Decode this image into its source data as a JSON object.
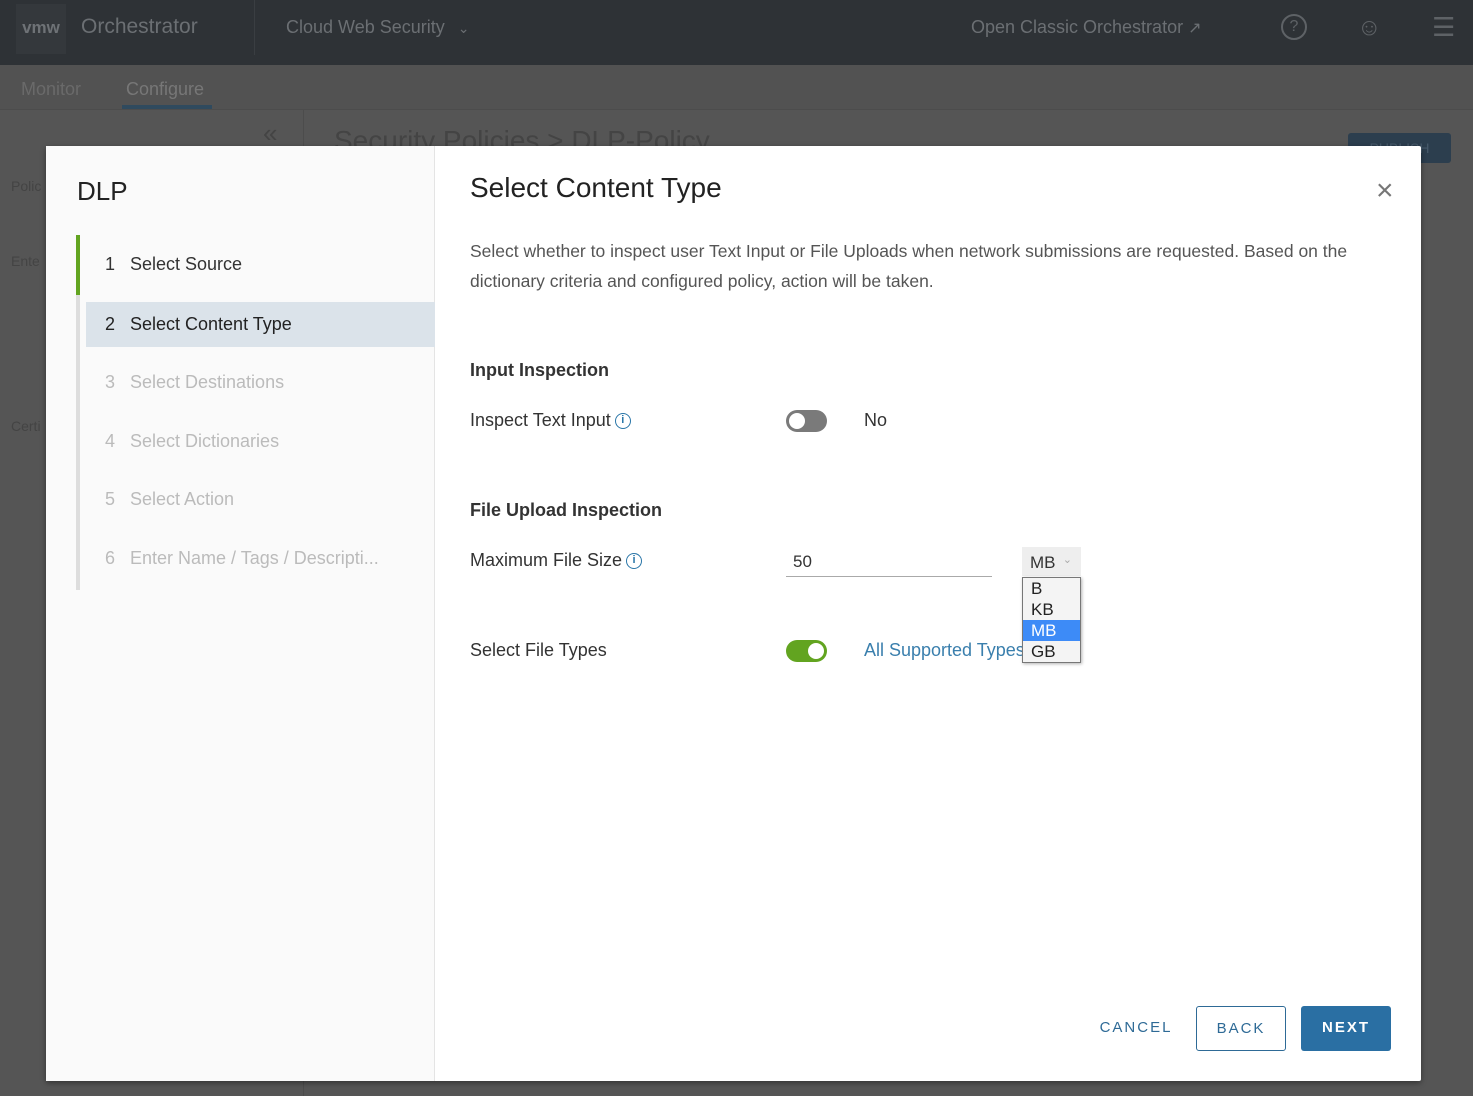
{
  "header": {
    "logo": "vmw",
    "app_name": "Orchestrator",
    "context": "Cloud Web Security",
    "open_classic": "Open Classic Orchestrator",
    "icons": [
      "external-link-icon",
      "help-icon",
      "user-icon",
      "menu-icon"
    ]
  },
  "subnav": {
    "tabs": [
      {
        "label": "Monitor"
      },
      {
        "label": "Configure",
        "active": true
      }
    ]
  },
  "background": {
    "breadcrumb": "Security Policies > DLP-Policy",
    "publish": "PUBLISH",
    "side_sections": [
      "Polic",
      "Ente",
      "Certi"
    ]
  },
  "modal": {
    "wizard_title": "DLP",
    "steps": [
      {
        "num": "1",
        "label": "Select Source",
        "state": "done"
      },
      {
        "num": "2",
        "label": "Select Content Type",
        "state": "current"
      },
      {
        "num": "3",
        "label": "Select Destinations",
        "state": "pending"
      },
      {
        "num": "4",
        "label": "Select Dictionaries",
        "state": "pending"
      },
      {
        "num": "5",
        "label": "Select Action",
        "state": "pending"
      },
      {
        "num": "6",
        "label": "Enter Name / Tags / Descripti...",
        "state": "pending"
      }
    ],
    "title": "Select Content Type",
    "description": "Select whether to inspect user Text Input or File Uploads when network submissions are requested. Based on the dictionary criteria and configured policy, action will be taken.",
    "input_inspection": {
      "heading": "Input Inspection",
      "label": "Inspect Text Input",
      "toggle_on": false,
      "value": "No"
    },
    "file_upload": {
      "heading": "File Upload Inspection",
      "max_size_label": "Maximum File Size",
      "max_size_value": "50",
      "unit": "MB",
      "unit_options": [
        "B",
        "KB",
        "MB",
        "GB"
      ],
      "file_types_label": "Select File Types",
      "file_types_on": true,
      "file_types_value": "All Supported Types"
    },
    "buttons": {
      "cancel": "CANCEL",
      "back": "BACK",
      "next": "NEXT"
    }
  },
  "colors": {
    "accent": "#2a6fa3",
    "green": "#62a420",
    "highlight": "#3d8bf7"
  }
}
